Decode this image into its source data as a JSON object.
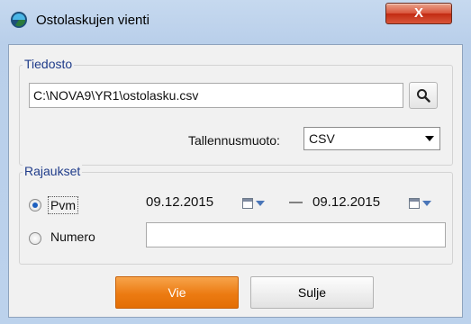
{
  "window": {
    "title": "Ostolaskujen vienti",
    "close_label": "X"
  },
  "file_group": {
    "label": "Tiedosto",
    "path_value": "C:\\NOVA9\\YR1\\ostolasku.csv",
    "format_label": "Tallennusmuoto:",
    "format_value": "CSV"
  },
  "limits_group": {
    "label": "Rajaukset",
    "date_option_label": "Pvm",
    "date_from": "09.12.2015",
    "date_separator": "—",
    "date_to": "09.12.2015",
    "number_option_label": "Numero",
    "number_value": "",
    "selected_option": "Pvm"
  },
  "buttons": {
    "primary_label": "Vie",
    "close_label": "Sulje"
  },
  "colors": {
    "accent": "#ec7b12",
    "group_label": "#1f3c8a",
    "close_button": "#c22b12"
  }
}
